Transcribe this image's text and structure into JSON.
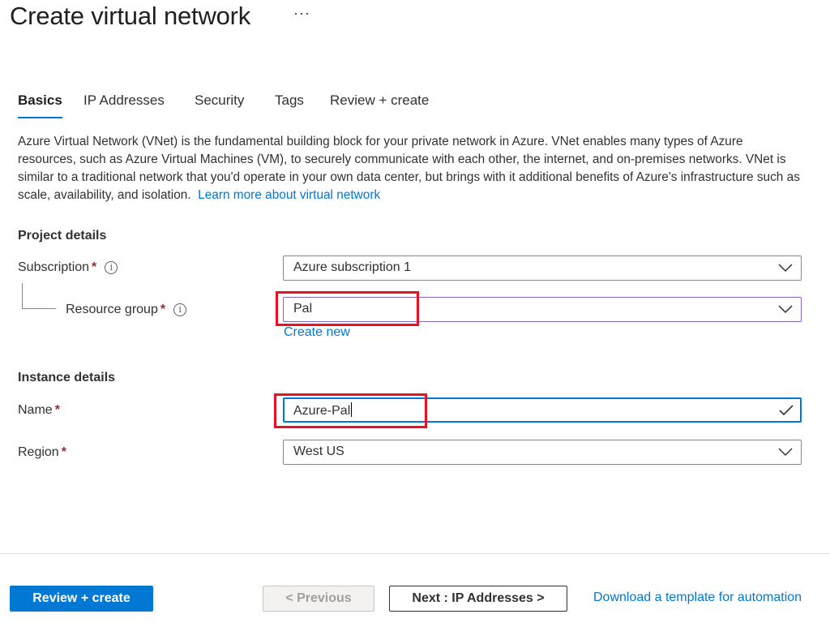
{
  "header": {
    "title": "Create virtual network",
    "more_label": "···"
  },
  "tabs": [
    {
      "label": "Basics"
    },
    {
      "label": "IP Addresses"
    },
    {
      "label": "Security"
    },
    {
      "label": "Tags"
    },
    {
      "label": "Review + create"
    }
  ],
  "description": {
    "text": "Azure Virtual Network (VNet) is the fundamental building block for your private network in Azure. VNet enables many types of Azure resources, such as Azure Virtual Machines (VM), to securely communicate with each other, the internet, and on-premises networks. VNet is similar to a traditional network that you'd operate in your own data center, but brings with it additional benefits of Azure's infrastructure such as scale, availability, and isolation.",
    "link": "Learn more about virtual network"
  },
  "project_details": {
    "heading": "Project details",
    "subscription": {
      "label": "Subscription",
      "required": "*",
      "value": "Azure subscription 1"
    },
    "resource_group": {
      "label": "Resource group",
      "required": "*",
      "value": "Pal",
      "create_new": "Create new"
    }
  },
  "instance_details": {
    "heading": "Instance details",
    "name": {
      "label": "Name",
      "required": "*",
      "value": "Azure-Pal"
    },
    "region": {
      "label": "Region",
      "required": "*",
      "value": "West US"
    }
  },
  "footer": {
    "review_create": "Review + create",
    "previous": "< Previous",
    "next": "Next : IP Addresses >",
    "download": "Download a template for automation"
  },
  "colors": {
    "accent": "#0078d4",
    "required": "#a4262c",
    "highlight": "#e81123"
  }
}
